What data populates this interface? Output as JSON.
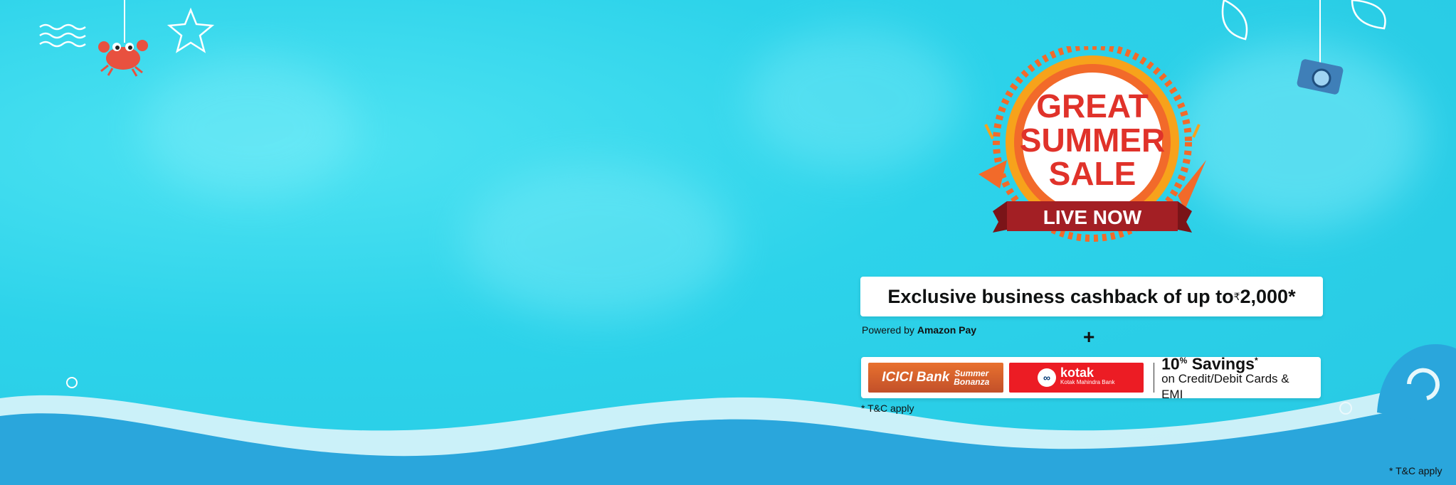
{
  "badge": {
    "line1": "GREAT",
    "line2": "SUMMER",
    "line3": "SALE",
    "ribbon": "LIVE NOW"
  },
  "offer": {
    "cashback_text": "Exclusive business cashback of up to ",
    "currency": "₹",
    "amount": "2,000*",
    "powered_prefix": "Powered by ",
    "powered_brand": "Amazon Pay",
    "plus": "+"
  },
  "banks": {
    "icici_name": "ICICI Bank",
    "icici_tag_1": "Summer",
    "icici_tag_2": "Bonanza",
    "kotak_name": "kotak",
    "kotak_sub": "Kotak Mahindra Bank",
    "savings_value": "10",
    "savings_unit": "%",
    "savings_label": " Savings",
    "savings_mark": "*",
    "savings_detail": "on Credit/Debit Cards & EMI"
  },
  "terms": {
    "tc_left": "* T&C apply",
    "tc_right": "* T&C apply"
  },
  "colors": {
    "water": "#27c8e3",
    "wave": "#2aa6dc",
    "badge_red": "#e0322a",
    "ribbon": "#a31f24"
  }
}
